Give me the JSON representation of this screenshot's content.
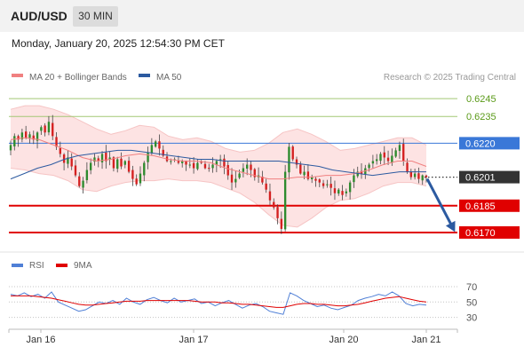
{
  "header": {
    "symbol": "AUD/USD",
    "timeframe": "30 MIN",
    "datetime": "Monday, January 20, 2025 12:54:30 PM CET"
  },
  "colors": {
    "bollinger_line": "#f08080",
    "bollinger_fill": "#fde0e0",
    "ma50": "#2c5aa0",
    "candle_up": "#2e8b2e",
    "candle_down": "#d42020",
    "resistance": "#a3c875",
    "pivot_level": "#3a78d8",
    "support": "#e00000",
    "current_price_badge": "#333333",
    "arrow": "#2c5aa0",
    "rsi_line": "#4f7fd6",
    "rsi_ma_line": "#e00000"
  },
  "chart_data": [
    {
      "type": "candlestick",
      "title": "",
      "legend": [
        {
          "name": "MA 20 + Bollinger Bands",
          "color": "#f08080"
        },
        {
          "name": "MA 50",
          "color": "#2c5aa0"
        }
      ],
      "legend_position": "top-left",
      "watermark": "Research © 2025 Trading Central",
      "x_labels": [
        "Jan 16",
        "Jan 17",
        "Jan 20",
        "Jan 21"
      ],
      "y_range": [
        0.6165,
        0.6253
      ],
      "levels": [
        {
          "value": 0.6245,
          "label": "0.6245",
          "role": "resistance"
        },
        {
          "value": 0.6235,
          "label": "0.6235",
          "role": "resistance"
        },
        {
          "value": 0.622,
          "label": "0.6220",
          "role": "pivot"
        },
        {
          "value": 0.6185,
          "label": "0.6185",
          "role": "support"
        },
        {
          "value": 0.617,
          "label": "0.6170",
          "role": "support"
        }
      ],
      "current_price": {
        "value": 0.6201,
        "label": "0.6201"
      },
      "forecast_arrow": {
        "from": 0.62,
        "to": 0.617
      },
      "close_path": [
        0.6219,
        0.6224,
        0.6222,
        0.6226,
        0.6223,
        0.6225,
        0.6222,
        0.6226,
        0.6229,
        0.6226,
        0.6232,
        0.6224,
        0.6218,
        0.6214,
        0.6209,
        0.6212,
        0.6207,
        0.6202,
        0.6196,
        0.6199,
        0.6205,
        0.6209,
        0.6212,
        0.621,
        0.6214,
        0.621,
        0.6212,
        0.6206,
        0.6211,
        0.6207,
        0.621,
        0.6204,
        0.62,
        0.6197,
        0.6203,
        0.6209,
        0.6215,
        0.6219,
        0.6221,
        0.6217,
        0.6213,
        0.621,
        0.621,
        0.6211,
        0.6209,
        0.621,
        0.6208,
        0.6208,
        0.6206,
        0.6209,
        0.6209,
        0.6206,
        0.6206,
        0.6208,
        0.621,
        0.6211,
        0.6207,
        0.6202,
        0.6198,
        0.62,
        0.6203,
        0.6206,
        0.6208,
        0.6205,
        0.6201,
        0.6202,
        0.6198,
        0.6194,
        0.6188,
        0.6184,
        0.6178,
        0.6172,
        0.6204,
        0.6218,
        0.6211,
        0.6208,
        0.6203,
        0.6204,
        0.62,
        0.6201,
        0.6199,
        0.6198,
        0.6196,
        0.6197,
        0.6195,
        0.6192,
        0.6194,
        0.6191,
        0.6193,
        0.6198,
        0.6202,
        0.6204,
        0.6203,
        0.6206,
        0.6208,
        0.621,
        0.6211,
        0.6214,
        0.6212,
        0.621,
        0.6213,
        0.6216,
        0.6219,
        0.621,
        0.6204,
        0.6201,
        0.6203,
        0.62,
        0.6202,
        0.6201
      ],
      "ma50_path": [
        0.62,
        0.6203,
        0.6206,
        0.6208,
        0.6211,
        0.6213,
        0.6214,
        0.6215,
        0.6216,
        0.6216,
        0.6215,
        0.6214,
        0.6213,
        0.6212,
        0.6211,
        0.6211,
        0.621,
        0.621,
        0.621,
        0.621,
        0.621,
        0.6209,
        0.6208,
        0.6207,
        0.6205,
        0.6204,
        0.6203,
        0.6202,
        0.6203,
        0.6204,
        0.6204,
        0.6204
      ],
      "bollinger_upper": [
        0.6239,
        0.6241,
        0.6241,
        0.6239,
        0.6236,
        0.6232,
        0.6228,
        0.6225,
        0.6227,
        0.623,
        0.6229,
        0.6224,
        0.6222,
        0.6223,
        0.6221,
        0.6217,
        0.6215,
        0.6216,
        0.622,
        0.6226,
        0.6228,
        0.6225,
        0.6221,
        0.6216,
        0.6217,
        0.6219,
        0.6221,
        0.6223,
        0.6223,
        0.6219
      ],
      "bollinger_lower": [
        0.6206,
        0.6205,
        0.6203,
        0.6202,
        0.6199,
        0.6194,
        0.6193,
        0.6196,
        0.6198,
        0.6199,
        0.6199,
        0.62,
        0.6199,
        0.6199,
        0.6198,
        0.6195,
        0.6192,
        0.6187,
        0.618,
        0.6174,
        0.6173,
        0.6178,
        0.6184,
        0.6188,
        0.6189,
        0.6192,
        0.6196,
        0.6198,
        0.6198,
        0.6196
      ],
      "bollinger_mid": [
        0.6222,
        0.6223,
        0.6222,
        0.6219,
        0.6216,
        0.6212,
        0.621,
        0.6211,
        0.6213,
        0.6214,
        0.6213,
        0.6211,
        0.621,
        0.621,
        0.6209,
        0.6206,
        0.6204,
        0.6202,
        0.62,
        0.62,
        0.6201,
        0.6201,
        0.6202,
        0.6202,
        0.6203,
        0.6205,
        0.6208,
        0.621,
        0.621,
        0.6207
      ]
    },
    {
      "type": "line",
      "title": "",
      "legend": [
        {
          "name": "RSI",
          "color": "#4f7fd6"
        },
        {
          "name": "9MA",
          "color": "#e00000"
        }
      ],
      "y_ticks": [
        70,
        50,
        30
      ],
      "y_range": [
        25,
        78
      ],
      "series": [
        {
          "name": "RSI",
          "values": [
            60,
            58,
            62,
            57,
            60,
            55,
            63,
            50,
            46,
            42,
            38,
            40,
            45,
            50,
            48,
            52,
            47,
            55,
            50,
            47,
            53,
            56,
            52,
            49,
            55,
            50,
            52,
            54,
            48,
            50,
            45,
            49,
            52,
            47,
            42,
            46,
            48,
            44,
            38,
            36,
            34,
            62,
            58,
            52,
            48,
            44,
            46,
            42,
            40,
            43,
            46,
            52,
            55,
            57,
            60,
            58,
            63,
            58,
            48,
            45,
            47,
            46
          ]
        },
        {
          "name": "9MA",
          "values": [
            58,
            58,
            58,
            58,
            57,
            56,
            55,
            53,
            51,
            49,
            47,
            46,
            46,
            47,
            48,
            49,
            50,
            51,
            51,
            51,
            52,
            52,
            52,
            52,
            52,
            52,
            52,
            51,
            50,
            50,
            50,
            49,
            49,
            48,
            47,
            47,
            46,
            45,
            44,
            43,
            43,
            45,
            47,
            48,
            48,
            47,
            47,
            46,
            45,
            45,
            46,
            47,
            49,
            51,
            53,
            55,
            56,
            57,
            55,
            53,
            51,
            50
          ]
        }
      ]
    }
  ]
}
